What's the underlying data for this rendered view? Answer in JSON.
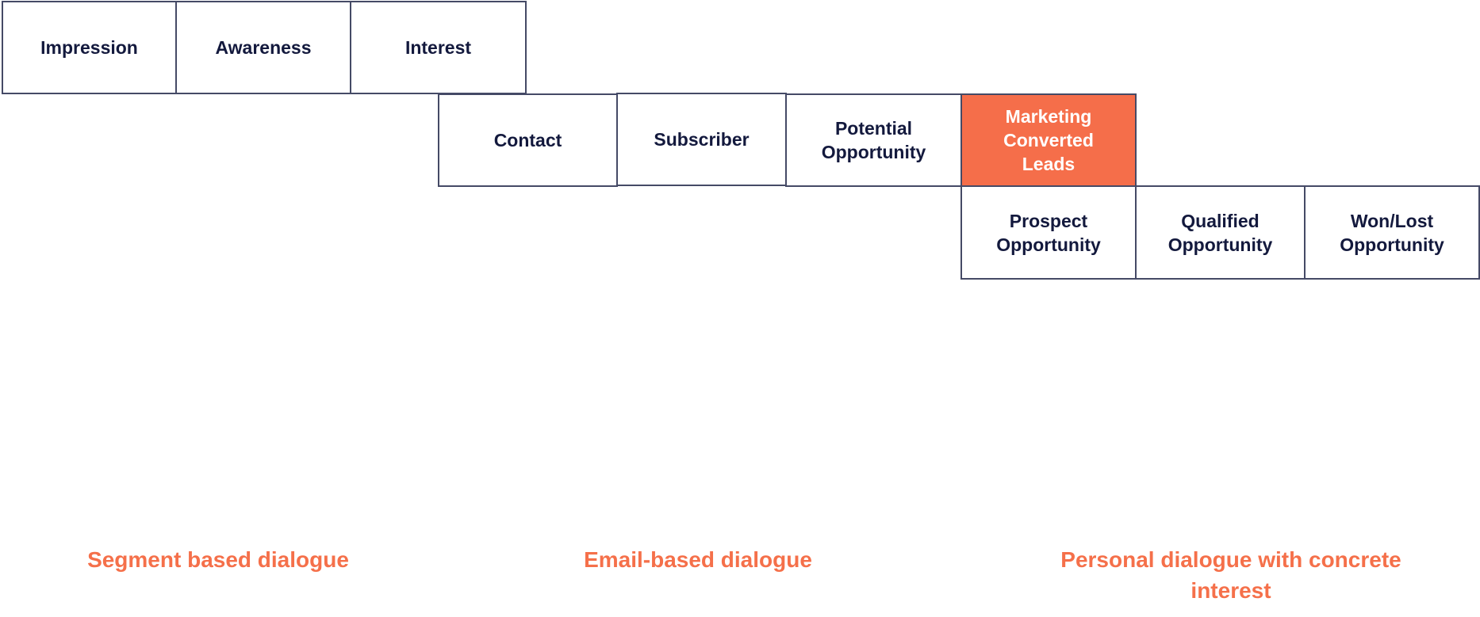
{
  "diagram": {
    "stages": {
      "impression": "Impression",
      "awareness": "Awareness",
      "interest": "Interest",
      "contact": "Contact",
      "subscriber": "Subscriber",
      "potential_opportunity": "Potential\nOpportunity",
      "marketing_converted_leads": "Marketing\nConverted\nLeads",
      "prospect_opportunity": "Prospect\nOpportunity",
      "qualified_opportunity": "Qualified\nOpportunity",
      "won_lost_opportunity": "Won/Lost\nOpportunity"
    },
    "rows": [
      [
        "impression",
        "awareness",
        "interest"
      ],
      [
        "contact",
        "subscriber",
        "potential_opportunity",
        "marketing_converted_leads"
      ],
      [
        "prospect_opportunity",
        "qualified_opportunity",
        "won_lost_opportunity"
      ]
    ],
    "highlighted_stage": "marketing_converted_leads",
    "phases": {
      "segment": "Segment based dialogue",
      "email": "Email-based dialogue",
      "personal": "Personal dialogue with concrete\ninterest"
    },
    "colors": {
      "accent": "#f56e4a",
      "phase_text": "#f5704a",
      "box_border": "#454a66",
      "box_text": "#13193d",
      "highlight_text": "#ffffff"
    }
  }
}
